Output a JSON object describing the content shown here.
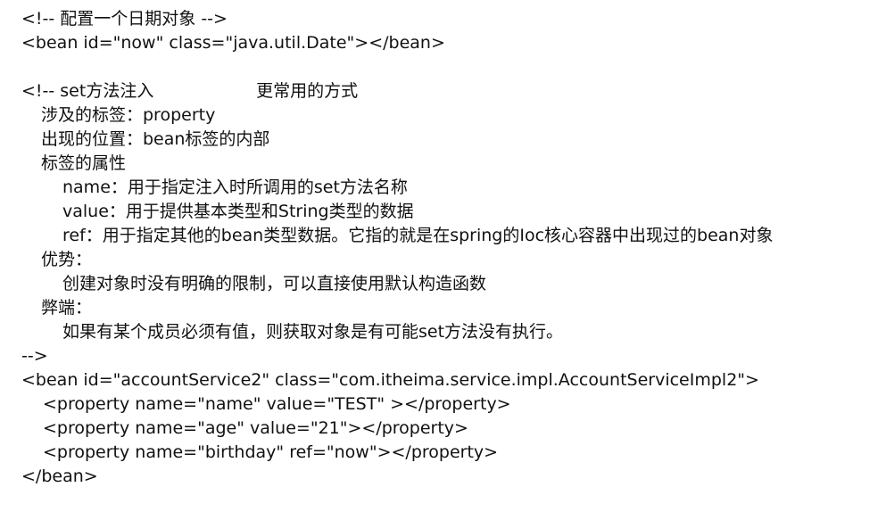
{
  "lines": [
    "<!-- 配置一个日期对象 -->",
    "<bean id=\"now\" class=\"java.util.Date\"></bean>",
    "<!-- set方法注入                   更常用的方式",
    "涉及的标签：property",
    "出现的位置：bean标签的内部",
    "标签的属性",
    "name：用于指定注入时所调用的set方法名称",
    "value：用于提供基本类型和String类型的数据",
    "ref：用于指定其他的bean类型数据。它指的就是在spring的Ioc核心容器中出现过的bean对象",
    "优势：",
    "创建对象时没有明确的限制，可以直接使用默认构造函数",
    "弊端：",
    "如果有某个成员必须有值，则获取对象是有可能set方法没有执行。",
    "-->",
    "<bean id=\"accountService2\" class=\"com.itheima.service.impl.AccountServiceImpl2\">",
    "<property name=\"name\" value=\"TEST\" ></property>",
    "<property name=\"age\" value=\"21\"></property>",
    "<property name=\"birthday\" ref=\"now\"></property>",
    "</bean>"
  ]
}
